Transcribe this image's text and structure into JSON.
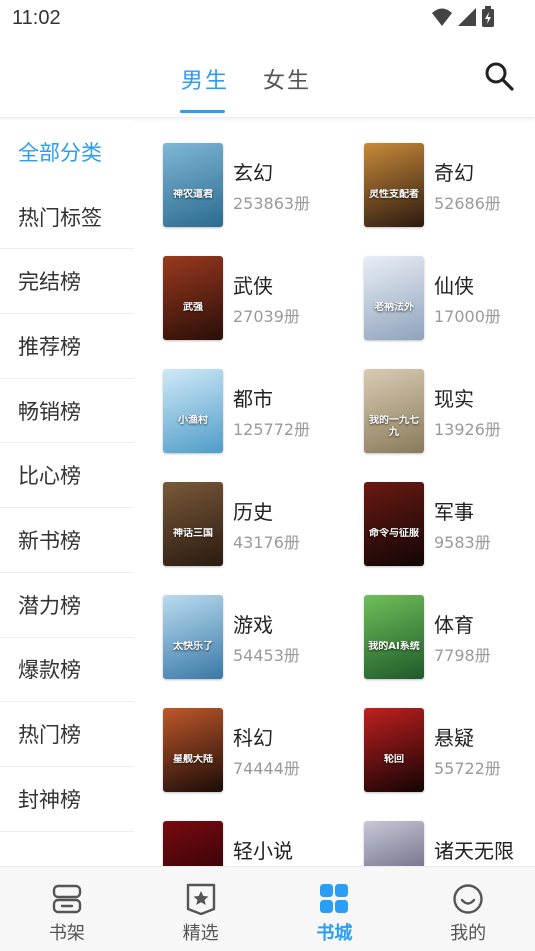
{
  "status_bar": {
    "time": "11:02"
  },
  "top_tabs": {
    "male": "男生",
    "female": "女生"
  },
  "sidebar": {
    "items": [
      {
        "label": "全部分类",
        "active": true
      },
      {
        "label": "热门标签"
      },
      {
        "label": "完结榜"
      },
      {
        "label": "推荐榜"
      },
      {
        "label": "畅销榜"
      },
      {
        "label": "比心榜"
      },
      {
        "label": "新书榜"
      },
      {
        "label": "潜力榜"
      },
      {
        "label": "爆款榜"
      },
      {
        "label": "热门榜"
      },
      {
        "label": "封神榜"
      }
    ]
  },
  "categories": [
    {
      "name": "玄幻",
      "count": "253863册",
      "cover_text": "神农道君",
      "cover_colors": [
        "#7fb7d6",
        "#2c6b8f"
      ]
    },
    {
      "name": "奇幻",
      "count": "52686册",
      "cover_text": "灵性支配者",
      "cover_colors": [
        "#c98a3a",
        "#2b1a10"
      ]
    },
    {
      "name": "武侠",
      "count": "27039册",
      "cover_text": "武强",
      "cover_colors": [
        "#9a3a1e",
        "#2a0e08"
      ]
    },
    {
      "name": "仙侠",
      "count": "17000册",
      "cover_text": "老衲法外",
      "cover_colors": [
        "#e9eef5",
        "#8fa3bc"
      ]
    },
    {
      "name": "都市",
      "count": "125772册",
      "cover_text": "小渔村",
      "cover_colors": [
        "#cfe9f7",
        "#4f9cc9"
      ]
    },
    {
      "name": "现实",
      "count": "13926册",
      "cover_text": "我的一九七九",
      "cover_colors": [
        "#d8ccb4",
        "#8a7a5a"
      ]
    },
    {
      "name": "历史",
      "count": "43176册",
      "cover_text": "神话三国",
      "cover_colors": [
        "#7a5a3a",
        "#2a1a10"
      ]
    },
    {
      "name": "军事",
      "count": "9583册",
      "cover_text": "命令与征服",
      "cover_colors": [
        "#6a1a12",
        "#120606"
      ]
    },
    {
      "name": "游戏",
      "count": "54453册",
      "cover_text": "太快乐了",
      "cover_colors": [
        "#b9dcef",
        "#3a78a8"
      ]
    },
    {
      "name": "体育",
      "count": "7798册",
      "cover_text": "我的AI系统",
      "cover_colors": [
        "#6fbf5a",
        "#1f5a2a"
      ]
    },
    {
      "name": "科幻",
      "count": "74444册",
      "cover_text": "星舰大陆",
      "cover_colors": [
        "#c0582a",
        "#1a0c08"
      ]
    },
    {
      "name": "悬疑",
      "count": "55722册",
      "cover_text": "轮回",
      "cover_colors": [
        "#c02020",
        "#140404"
      ]
    },
    {
      "name": "轻小说",
      "count": "",
      "cover_text": "",
      "cover_colors": [
        "#7a0a10",
        "#1a0204"
      ]
    },
    {
      "name": "诸天无限",
      "count": "",
      "cover_text": "",
      "cover_colors": [
        "#c8c8d8",
        "#4a4a66"
      ]
    }
  ],
  "bottom_nav": {
    "items": [
      {
        "label": "书架",
        "icon": "bookshelf-icon"
      },
      {
        "label": "精选",
        "icon": "featured-icon"
      },
      {
        "label": "书城",
        "icon": "bookstore-icon",
        "active": true
      },
      {
        "label": "我的",
        "icon": "profile-icon"
      }
    ]
  },
  "colors": {
    "accent": "#2a9df4"
  }
}
